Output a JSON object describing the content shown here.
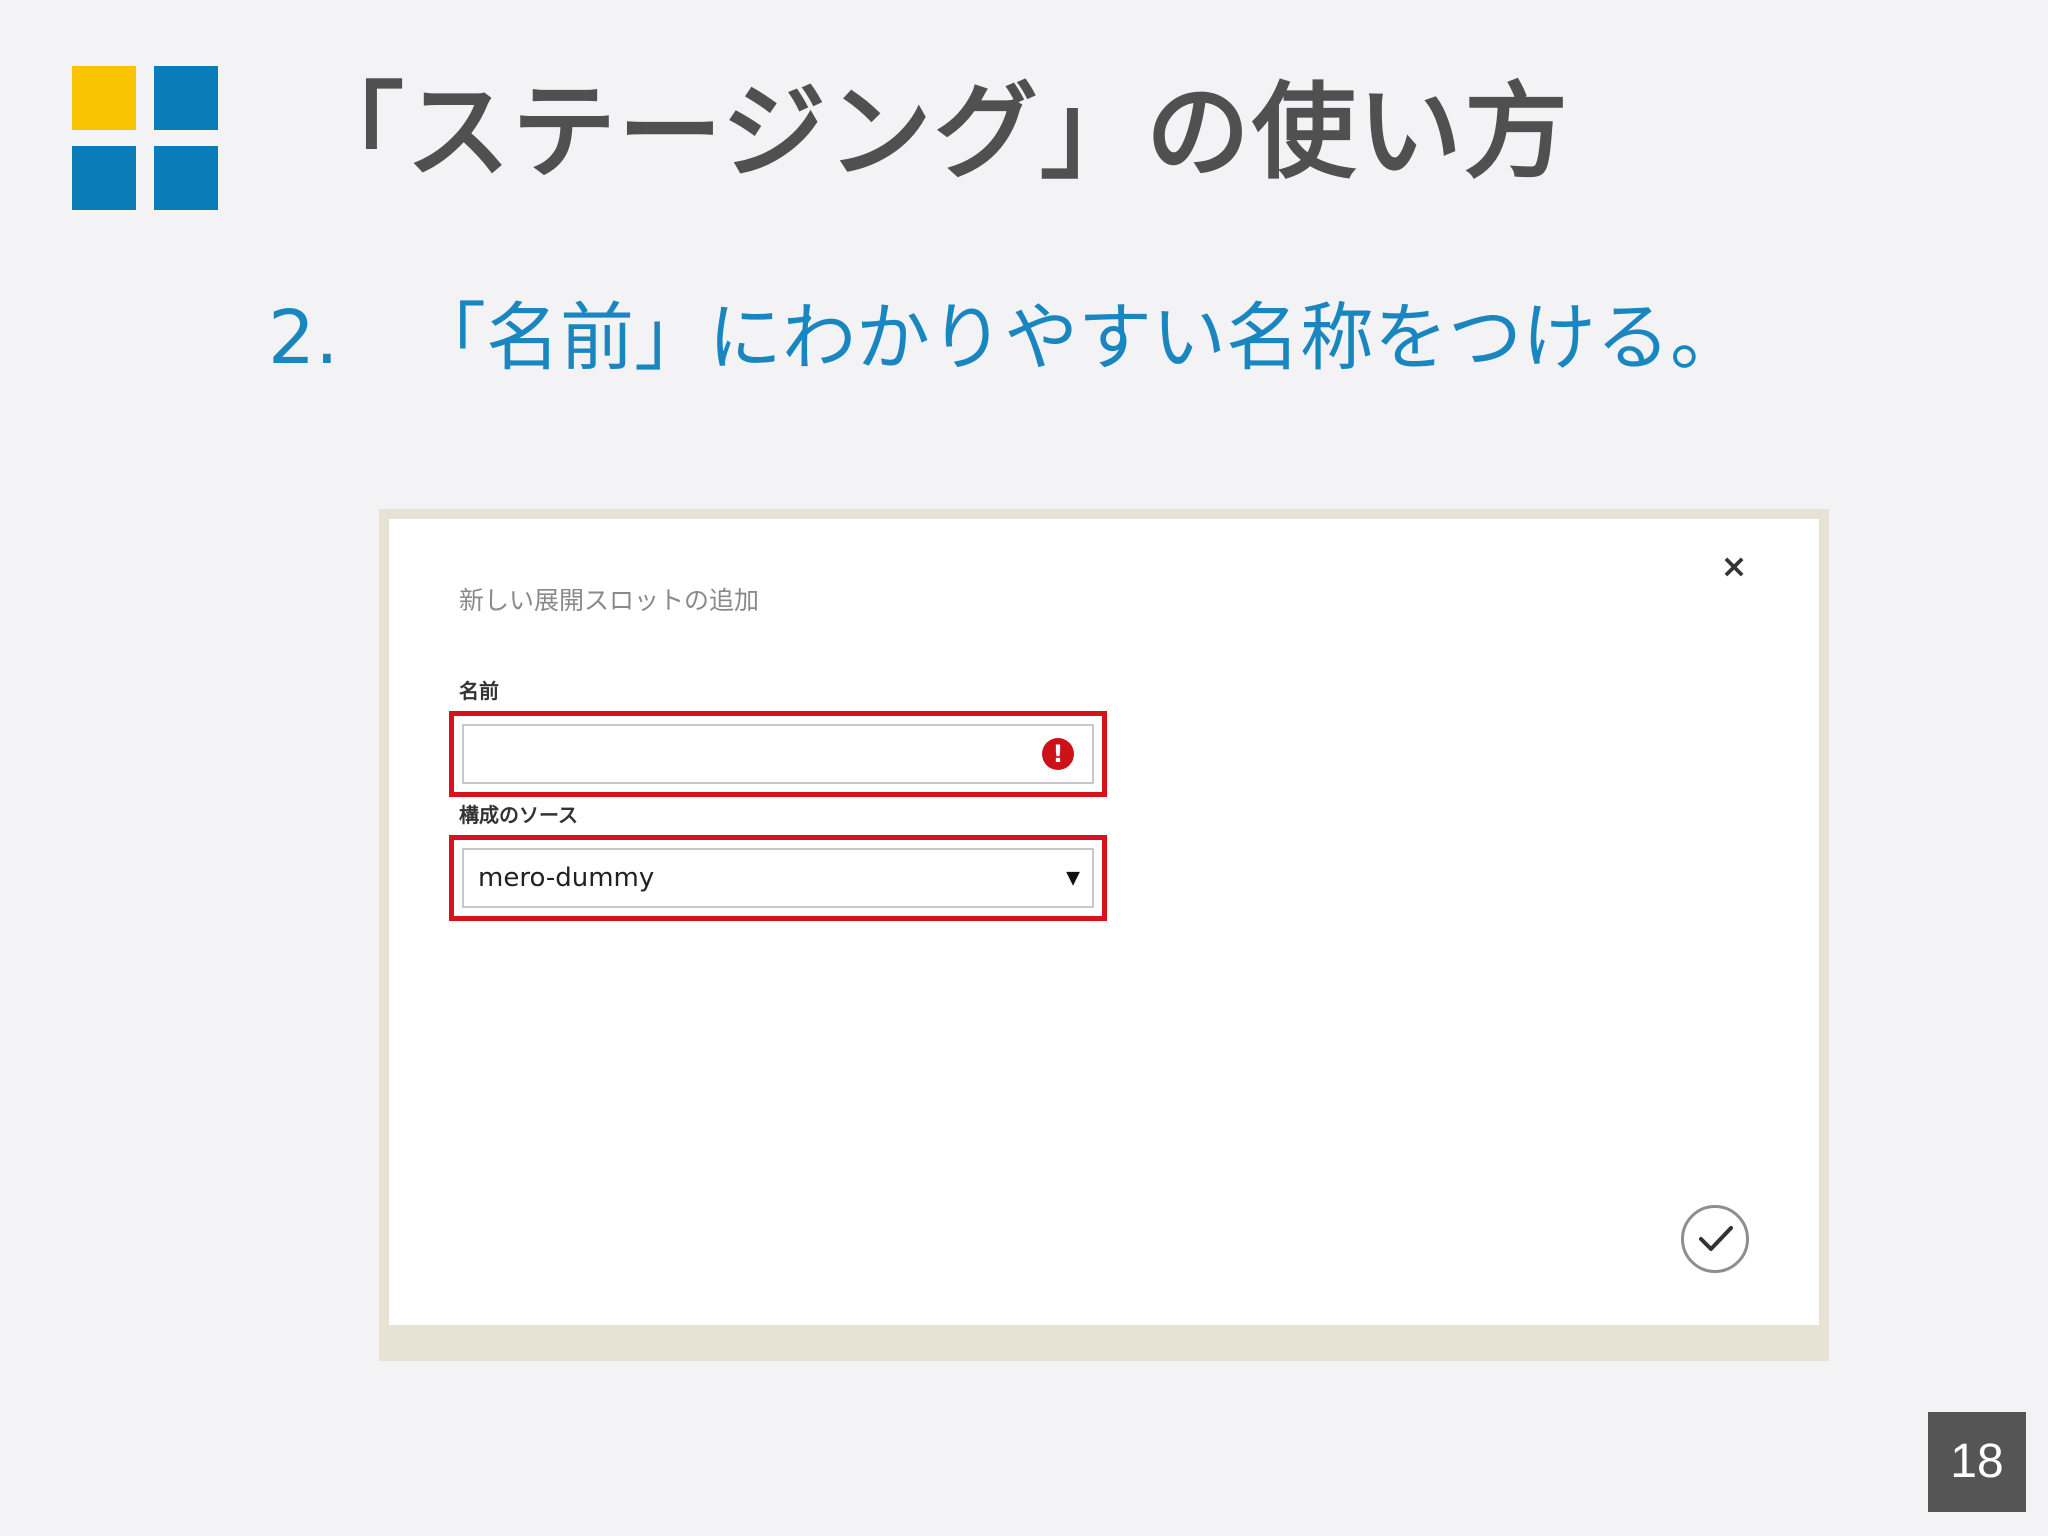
{
  "slide": {
    "title": "「ステージング」の使い方",
    "step_number": "2.",
    "step_text": "「名前」にわかりやすい名称をつける。",
    "page_number": "18"
  },
  "dialog": {
    "title": "新しい展開スロットの追加",
    "close_symbol": "×",
    "fields": {
      "name": {
        "label": "名前",
        "value": "",
        "error_symbol": "!"
      },
      "source": {
        "label": "構成のソース",
        "selected": "mero-dummy",
        "arrow_symbol": "▼"
      }
    }
  },
  "colors": {
    "accent": "#1a86c0",
    "logo_yellow": "#f8c300",
    "logo_blue": "#0a7db8",
    "highlight": "#d6131b",
    "title": "#505050"
  }
}
